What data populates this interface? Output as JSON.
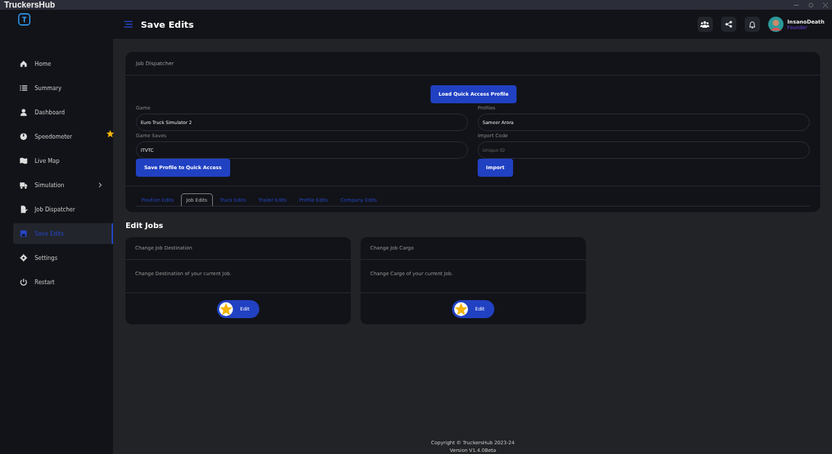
{
  "window": {
    "title": "TruckersHub"
  },
  "sidebar": {
    "items": [
      {
        "label": "Home",
        "selected": false,
        "starred": false,
        "has_submenu": false
      },
      {
        "label": "Summary",
        "selected": false,
        "starred": false,
        "has_submenu": false
      },
      {
        "label": "Dashboard",
        "selected": false,
        "starred": false,
        "has_submenu": false
      },
      {
        "label": "Speedometer",
        "selected": false,
        "starred": true,
        "has_submenu": false
      },
      {
        "label": "Live Map",
        "selected": false,
        "starred": false,
        "has_submenu": false
      },
      {
        "label": "Simulation",
        "selected": false,
        "starred": false,
        "has_submenu": true
      },
      {
        "label": "Job Dispatcher",
        "selected": false,
        "starred": false,
        "has_submenu": false
      },
      {
        "label": "Save Edits",
        "selected": true,
        "starred": false,
        "has_submenu": false
      },
      {
        "label": "Settings",
        "selected": false,
        "starred": false,
        "has_submenu": false
      },
      {
        "label": "Restart",
        "selected": false,
        "starred": false,
        "has_submenu": false
      }
    ]
  },
  "header": {
    "title": "Save Edits",
    "user": {
      "name": "InsanoDeath",
      "role": "Founder"
    }
  },
  "dispatcher": {
    "title": "Job Dispatcher",
    "load_button": "Load Quick Access Profile",
    "left": {
      "game_label": "Game",
      "game_value": "Euro Truck Simulator 2",
      "saves_label": "Game Saves",
      "saves_value": "ITVTC",
      "button": "Save Profile to Quick Access"
    },
    "right": {
      "profiles_label": "Profiles",
      "profiles_value": "Sameer Arora",
      "import_label": "Import Code",
      "import_placeholder": "Unique ID",
      "button": "Import"
    },
    "tabs": [
      {
        "label": "Position Edits",
        "selected": false
      },
      {
        "label": "Job Edits",
        "selected": true
      },
      {
        "label": "Truck Edits",
        "selected": false
      },
      {
        "label": "Trailer Edits",
        "selected": false
      },
      {
        "label": "Profile Edits",
        "selected": false
      },
      {
        "label": "Company Edits",
        "selected": false
      }
    ]
  },
  "section_title": "Edit Jobs",
  "cards": [
    {
      "title": "Change Job Destination",
      "description": "Change Destination of your current Job.",
      "button": "Edit"
    },
    {
      "title": "Change Job Cargo",
      "description": "Change Cargo of your current Job.",
      "button": "Edit"
    }
  ],
  "footer": {
    "copyright": "Copyright © TruckersHub 2023-24",
    "version": "Version V1.4.0Beta"
  }
}
